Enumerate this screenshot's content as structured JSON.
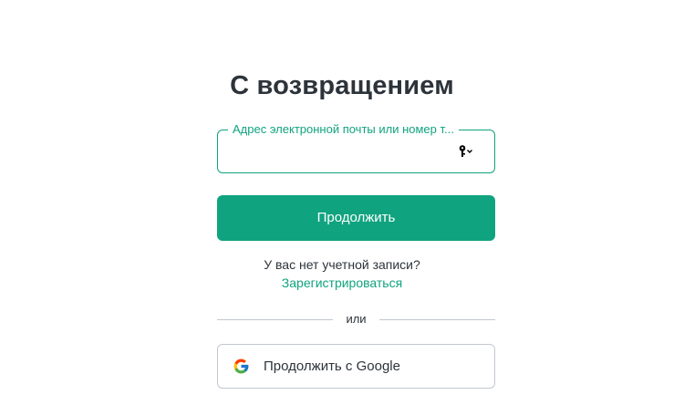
{
  "login": {
    "title": "С возвращением",
    "email_label": "Адрес электронной почты или номер т...",
    "email_value": "",
    "continue_label": "Продолжить",
    "no_account_text": "У вас нет учетной записи?",
    "signup_link": "Зарегистрироваться",
    "divider_text": "или",
    "google_label": "Продолжить с Google"
  },
  "icons": {
    "field_icon": "key-dropdown-icon",
    "google_icon": "google-logo-icon"
  },
  "colors": {
    "accent": "#10a37f",
    "text": "#2d333a",
    "border": "#c2c8d0"
  }
}
